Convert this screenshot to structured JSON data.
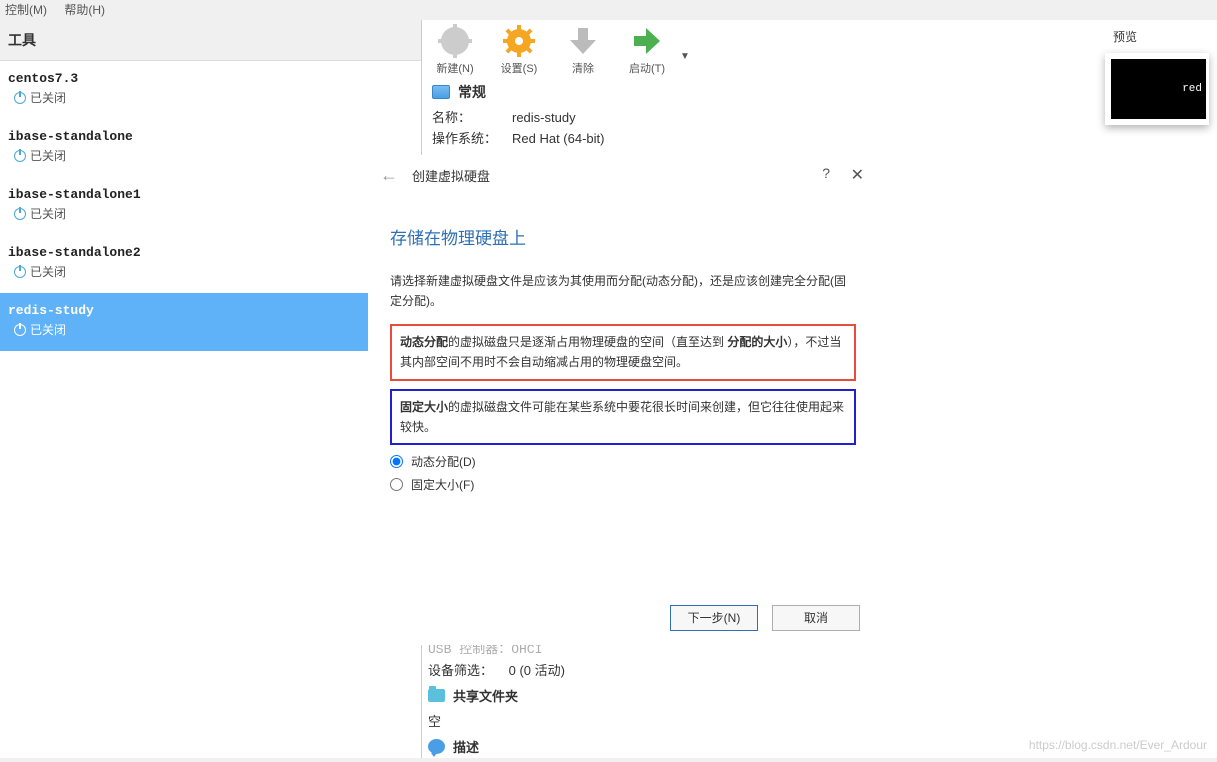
{
  "menu": {
    "control": "控制(M)",
    "help": "帮助(H)"
  },
  "sidebar": {
    "title": "工具",
    "vms": [
      {
        "name": "centos7.3",
        "status": "已关闭"
      },
      {
        "name": "ibase-standalone",
        "status": "已关闭"
      },
      {
        "name": "ibase-standalone1",
        "status": "已关闭"
      },
      {
        "name": "ibase-standalone2",
        "status": "已关闭"
      },
      {
        "name": "redis-study",
        "status": "已关闭"
      }
    ]
  },
  "toolbar": {
    "new": "新建(N)",
    "settings": "设置(S)",
    "clear": "清除",
    "start": "启动(T)"
  },
  "general": {
    "title": "常规",
    "name_label": "名称：",
    "name_value": "redis-study",
    "os_label": "操作系统：",
    "os_value": "Red Hat (64-bit)"
  },
  "dialog": {
    "title": "创建虚拟硬盘",
    "heading": "存储在物理硬盘上",
    "desc": "请选择新建虚拟硬盘文件是应该为其使用而分配(动态分配)，还是应该创建完全分配(固定分配)。",
    "red_bold1": "动态分配",
    "red_text": "的虚拟磁盘只是逐渐占用物理硬盘的空间（直至达到 ",
    "red_bold2": "分配的大小",
    "red_text2": "），不过当其内部空间不用时不会自动缩减占用的物理硬盘空间。",
    "blue_bold": "固定大小",
    "blue_text": "的虚拟磁盘文件可能在某些系统中要花很长时间来创建，但它往往使用起来较快。",
    "radio_dynamic": "动态分配(D)",
    "radio_fixed": "固定大小(F)",
    "next": "下一步(N)",
    "cancel": "取消"
  },
  "bottom": {
    "line1": "USB 控制器：OHCI",
    "line2_k": "设备筛选：",
    "line2_v": "0 (0 活动)",
    "shared_folders": "共享文件夹",
    "empty": "空",
    "description": "描述"
  },
  "preview": {
    "title": "预览",
    "screen_text": "red"
  },
  "watermark": "https://blog.csdn.net/Ever_Ardour"
}
